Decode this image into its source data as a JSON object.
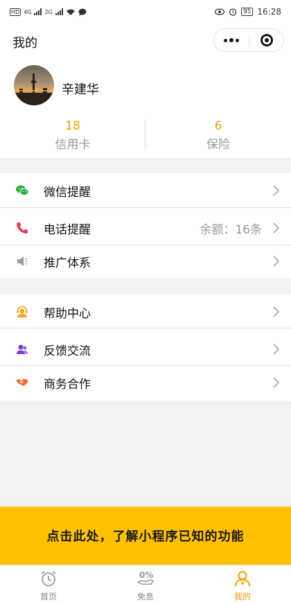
{
  "status_bar": {
    "left_badge": "HD",
    "signal_1": "4G",
    "signal_2": "2G",
    "battery": "95",
    "time": "16:28"
  },
  "nav": {
    "title": "我的"
  },
  "profile": {
    "name": "辛建华",
    "stats": [
      {
        "value": "18",
        "label": "信用卡"
      },
      {
        "value": "6",
        "label": "保险"
      }
    ]
  },
  "menu": {
    "group1": [
      {
        "label": "微信提醒",
        "icon": "wechat-icon"
      },
      {
        "label": "电话提醒",
        "icon": "phone-icon",
        "extra": "余额：16条"
      },
      {
        "label": "推广体系",
        "icon": "speaker-icon"
      }
    ],
    "group2": [
      {
        "label": "帮助中心",
        "icon": "headset-icon"
      },
      {
        "label": "反馈交流",
        "icon": "users-icon"
      },
      {
        "label": "商务合作",
        "icon": "handshake-icon"
      }
    ]
  },
  "banner": {
    "text": "点击此处，了解小程序已知的功能"
  },
  "tabs": [
    {
      "label": "首页",
      "icon": "alarm-clock-icon",
      "active": false
    },
    {
      "label": "免息",
      "icon": "zero-percent-icon",
      "active": false
    },
    {
      "label": "我的",
      "icon": "person-icon",
      "active": true
    }
  ],
  "colors": {
    "accent": "#f0a000",
    "banner_bg": "#ffc000",
    "active_tab": "#e6a300",
    "wechat_green": "#2aae3a",
    "phone_red": "#e33b50",
    "help_orange": "#f5a623",
    "feedback_purple": "#7a3fd6",
    "handshake_orange": "#f06a35"
  }
}
